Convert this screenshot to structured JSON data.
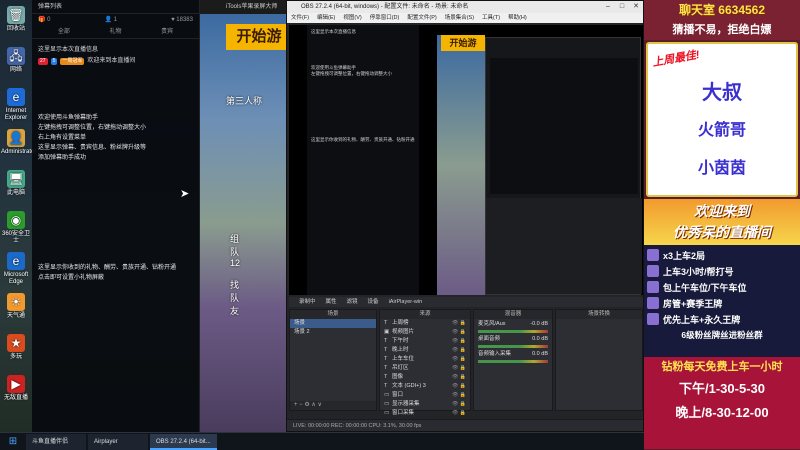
{
  "desktop": {
    "icons": [
      {
        "label": "回收站",
        "glyph": "🗑",
        "color": "#7aa"
      },
      {
        "label": "网络",
        "glyph": "🖧",
        "color": "#46a"
      },
      {
        "label": "Internet Explorer",
        "glyph": "e",
        "color": "#1e6ad6"
      },
      {
        "label": "Administrator",
        "glyph": "👤",
        "color": "#d9a441"
      },
      {
        "label": "此电脑",
        "glyph": "🖥",
        "color": "#4a8"
      },
      {
        "label": "360安全卫士",
        "glyph": "◉",
        "color": "#2a9d2a"
      },
      {
        "label": "Microsoft Edge",
        "glyph": "e",
        "color": "#1b6ac9"
      },
      {
        "label": "天气通",
        "glyph": "☀",
        "color": "#f29a2e"
      },
      {
        "label": "多玩",
        "glyph": "★",
        "color": "#d94c1f"
      },
      {
        "label": "无敌直播",
        "glyph": "▶",
        "color": "#c22"
      }
    ]
  },
  "chat": {
    "header": "弹幕列表",
    "stats": {
      "gift": "0",
      "users": "1",
      "likes": "18383"
    },
    "tabs": [
      "全部",
      "礼物",
      "贵宾"
    ],
    "line1": "这里显示本次直播信息",
    "line2_prefix": "一周冠军",
    "line2_suffix": "欢迎来到本直播间",
    "welcome": [
      "欢迎使用斗鱼弹幕助手",
      "左键拖拽可调整位置，右键拖动调整大小",
      "右上角有设置菜单",
      "这里显示弹幕、贵宾信息、粉丝牌升级等",
      "添加弹幕助手成功"
    ],
    "gifts": [
      "这里显示你收到的礼物、酬劳、贵族开通、钻粉开通",
      "点击即可设置小礼物屏蔽"
    ]
  },
  "game": {
    "start_text": "开始游",
    "subtitle": "第三人称",
    "team_text": "组队12",
    "find_text": "找队友"
  },
  "itools": {
    "title": "iTools苹果录屏大师 (AirPlay)"
  },
  "obs": {
    "title": "OBS 27.2.4 (64-bit, windows) - 配置文件: 未命名 - 场景: 未命名",
    "menu": [
      "文件(F)",
      "编辑(E)",
      "视图(V)",
      "停靠窗口(D)",
      "配置文件(P)",
      "场景集合(S)",
      "工具(T)",
      "帮助(H)"
    ],
    "controls": [
      "录制中",
      "属性",
      "滤镜",
      "设备",
      "iAirPlayer-win"
    ],
    "scenes_title": "场景",
    "scenes": [
      "场景",
      "场景 2"
    ],
    "sources_title": "来源",
    "sources": [
      {
        "icon": "T",
        "name": "上周榜"
      },
      {
        "icon": "▣",
        "name": "视频图片"
      },
      {
        "icon": "T",
        "name": "下午时"
      },
      {
        "icon": "T",
        "name": "晚上时"
      },
      {
        "icon": "T",
        "name": "上车车位"
      },
      {
        "icon": "T",
        "name": "吊灯区"
      },
      {
        "icon": "T",
        "name": "图像"
      },
      {
        "icon": "T",
        "name": "文本 (GDI+) 3"
      },
      {
        "icon": "▭",
        "name": "窗口"
      },
      {
        "icon": "▭",
        "name": "显示器采集"
      },
      {
        "icon": "▭",
        "name": "窗口采集"
      }
    ],
    "mixer_title": "混音器",
    "mixer": [
      {
        "name": "麦克风/Aux",
        "db": "-0.0 dB"
      },
      {
        "name": "桌面音频",
        "db": "0.0 dB"
      },
      {
        "name": "音频输入采集",
        "db": "0.0 dB"
      }
    ],
    "transitions_title": "场景转换",
    "tool_symbols": "+ − ⚙ ∧ ∨",
    "status": "LIVE: 00:00:00   REC: 00:00:00   CPU: 3.1%, 30.00 fps"
  },
  "overlay": {
    "fans": "聊天室 6634562",
    "tagline": "猜播不易，拒绝白嫖",
    "best_label": "上周最佳!",
    "names": [
      "大叔",
      "火箭哥",
      "小茵茵"
    ],
    "welcome": [
      "欢迎来到",
      "优秀呆的直播间"
    ],
    "rules": [
      "x3上车2局",
      "上车3小时/帮打号",
      "包上午车位/下午车位",
      "房管+赛季王牌",
      "优先上车+永久王牌"
    ],
    "fan_group": "6级粉丝牌丝进粉丝群",
    "diamond": "钻粉每天免费上车一小时",
    "afternoon": "下午/1-30-5-30",
    "evening": "晚上/8-30-12-00"
  },
  "taskbar": {
    "items": [
      "斗鱼直播伴侣",
      "Airplayer",
      "OBS 27.2.4 (64-bit..."
    ]
  }
}
